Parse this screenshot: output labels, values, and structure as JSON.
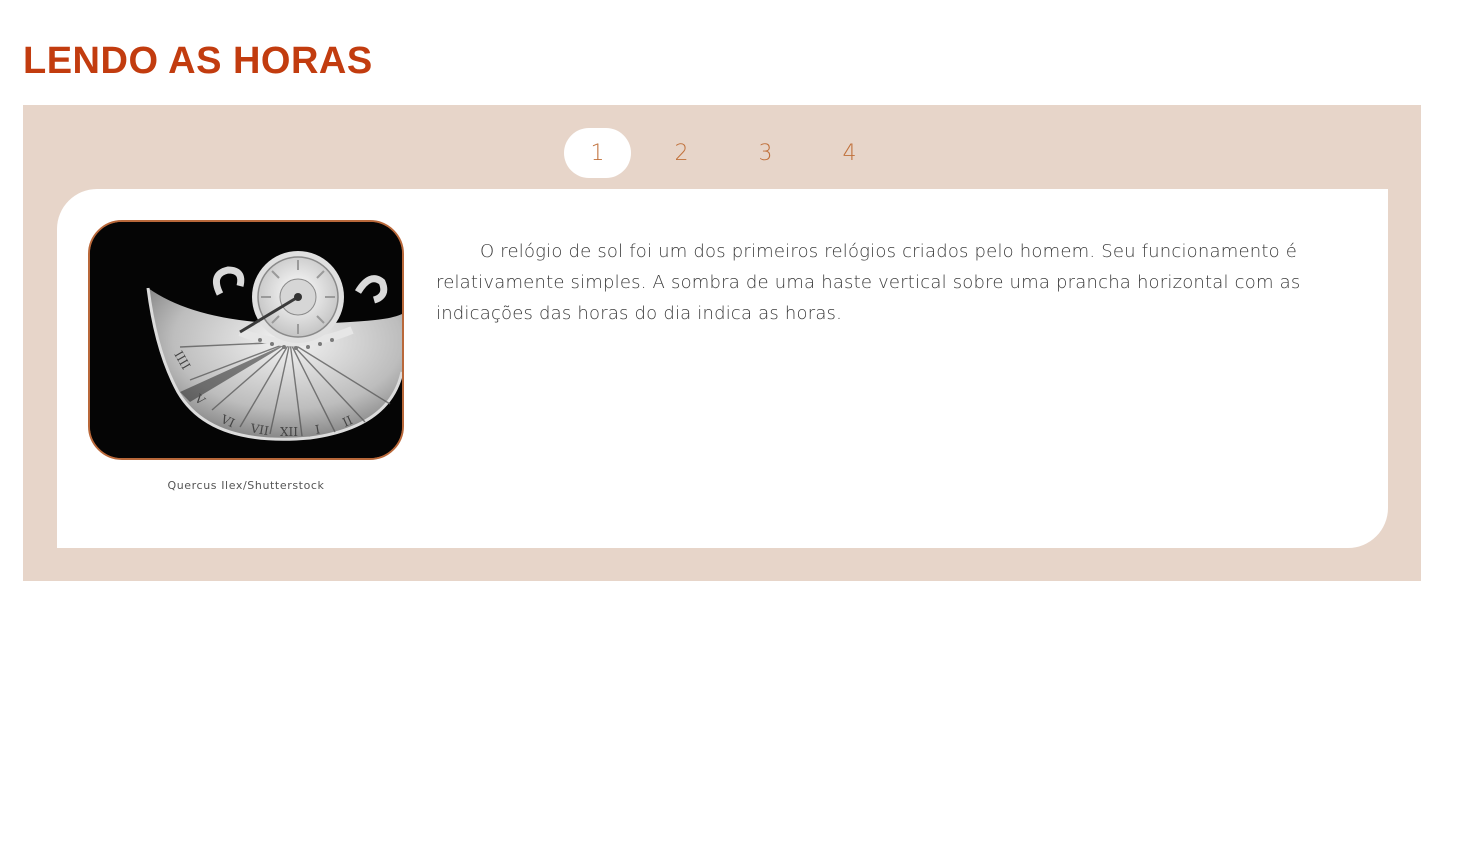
{
  "page": {
    "title": "LENDO AS HORAS"
  },
  "tabs": [
    {
      "label": "1",
      "active": true
    },
    {
      "label": "2",
      "active": false
    },
    {
      "label": "3",
      "active": false
    },
    {
      "label": "4",
      "active": false
    }
  ],
  "content": {
    "image": {
      "subject": "sundial-photo",
      "credit": "Quercus Ilex/Shutterstock"
    },
    "paragraph": "O relógio de sol foi um dos primeiros relógios criados pelo homem. Seu funcionamento é relativamente simples. A sombra de uma haste vertical sobre uma prancha horizontal com as indicações das horas do dia indica as horas."
  },
  "colors": {
    "title": "#c23c0f",
    "panel_bg": "#e7d5c9",
    "tab_text": "#c0703a",
    "image_border": "#b9683a"
  }
}
